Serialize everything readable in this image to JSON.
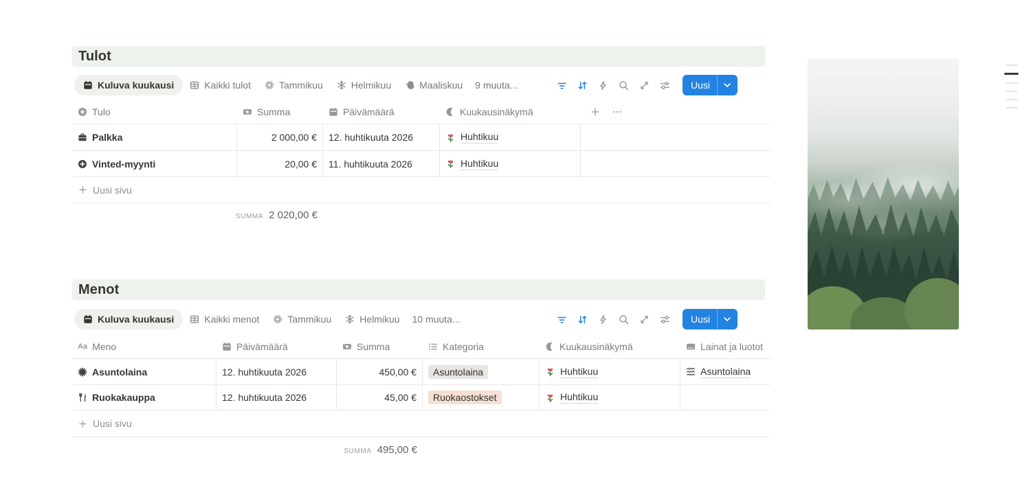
{
  "colors": {
    "accent_blue": "#2383e2",
    "band_green": "#edf3ec",
    "tag_gray": "#e6e5e2",
    "tag_orange": "#f6e0d3",
    "active_filter_icon": "#2383e2"
  },
  "sections": {
    "tulot": {
      "title": "Tulot",
      "tabs": [
        {
          "icon": "calendar-icon",
          "label": "Kuluva kuukausi",
          "active": true
        },
        {
          "icon": "table-icon",
          "label": "Kaikki tulot"
        },
        {
          "icon": "burst-icon",
          "label": "Tammikuu"
        },
        {
          "icon": "snowflake-icon",
          "label": "Helmikuu"
        },
        {
          "icon": "duck-icon",
          "label": "Maaliskuu"
        },
        {
          "label": "9 muuta..."
        }
      ],
      "toolbar_icons": [
        "filter-icon",
        "sort-icon",
        "lightning-icon",
        "search-icon",
        "expand-icon",
        "sliders-icon"
      ],
      "new_label": "Uusi",
      "columns": [
        {
          "icon": "plus-circle-icon",
          "label": "Tulo"
        },
        {
          "icon": "money-icon",
          "label": "Summa"
        },
        {
          "icon": "calendar-icon",
          "label": "Päivämäärä"
        },
        {
          "icon": "moon-icon",
          "label": "Kuukausinäkymä"
        }
      ],
      "add_property": "+",
      "property_menu": "···",
      "rows": [
        {
          "icon": "briefcase-icon",
          "name": "Palkka",
          "summa": "2 000,00 €",
          "date": "12. huhtikuuta 2026",
          "month_icon": "tulip-icon",
          "month": "Huhtikuu"
        },
        {
          "icon": "plus-circle-icon",
          "name": "Vinted-myynti",
          "summa": "20,00 €",
          "date": "11. huhtikuuta 2026",
          "month_icon": "tulip-icon",
          "month": "Huhtikuu"
        }
      ],
      "new_page": "Uusi sivu",
      "summary_label": "SUMMA",
      "summary_value": "2 020,00 €"
    },
    "menot": {
      "title": "Menot",
      "tabs": [
        {
          "icon": "calendar-icon",
          "label": "Kuluva kuukausi",
          "active": true
        },
        {
          "icon": "table-icon",
          "label": "Kaikki menot"
        },
        {
          "icon": "burst-icon",
          "label": "Tammikuu"
        },
        {
          "icon": "snowflake-icon",
          "label": "Helmikuu"
        },
        {
          "label": "10 muuta..."
        }
      ],
      "toolbar_icons": [
        "filter-icon",
        "sort-icon",
        "lightning-icon",
        "search-icon",
        "expand-icon",
        "sliders-icon"
      ],
      "new_label": "Uusi",
      "columns": [
        {
          "icon": "text-icon",
          "label": "Meno"
        },
        {
          "icon": "calendar-icon",
          "label": "Päivämäärä"
        },
        {
          "icon": "money-icon",
          "label": "Summa"
        },
        {
          "icon": "list-icon",
          "label": "Kategoria"
        },
        {
          "icon": "moon-icon",
          "label": "Kuukausinäkymä"
        },
        {
          "icon": "card-icon",
          "label": "Lainat ja luotot"
        }
      ],
      "rows": [
        {
          "icon": "rosette-icon",
          "name": "Asuntolaina",
          "date": "12. huhtikuuta 2026",
          "summa": "450,00 €",
          "category": "Asuntolaina",
          "category_color": "gray",
          "month_icon": "tulip-icon",
          "month": "Huhtikuu",
          "loan_icon": "wave-icon",
          "loan": "Asuntolaina"
        },
        {
          "icon": "cutlery-icon",
          "name": "Ruokakauppa",
          "date": "12. huhtikuuta 2026",
          "summa": "45,00 €",
          "category": "Ruokaostokset",
          "category_color": "orange",
          "month_icon": "tulip-icon",
          "month": "Huhtikuu",
          "loan": ""
        }
      ],
      "new_page": "Uusi sivu",
      "summary_label": "SUMMA",
      "summary_value": "495,00 €"
    }
  },
  "side_image": {
    "description": "Misty green forest photo"
  },
  "outline": {
    "lines": 6,
    "active_index": 1
  }
}
